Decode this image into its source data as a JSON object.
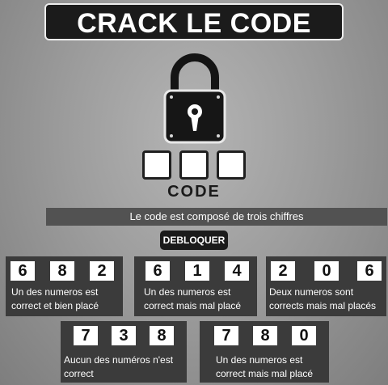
{
  "title": "CRACK LE CODE",
  "lock": {
    "icon": "padlock-icon",
    "code_label": "CODE",
    "slots": [
      "",
      "",
      ""
    ]
  },
  "info": "Le code est composé de trois chiffres",
  "unlock_button": "DEBLOQUER",
  "clues": [
    {
      "digits": [
        "6",
        "8",
        "2"
      ],
      "text_lines": [
        "Un des numeros est",
        "correct et bien placé"
      ]
    },
    {
      "digits": [
        "6",
        "1",
        "4"
      ],
      "text_lines": [
        "Un des numeros est",
        "correct mais mal placé"
      ]
    },
    {
      "digits": [
        "2",
        "0",
        "6"
      ],
      "text_lines": [
        "Deux numeros sont",
        "corrects mais mal placés"
      ]
    },
    {
      "digits": [
        "7",
        "3",
        "8"
      ],
      "text_lines": [
        "Aucun des numéros n'est",
        "correct"
      ]
    },
    {
      "digits": [
        "7",
        "8",
        "0"
      ],
      "text_lines": [
        "Un des numeros est",
        "correct mais mal placé"
      ]
    }
  ],
  "colors": {
    "panel": "#3b3b3b",
    "bar": "#525252",
    "dark": "#1b1b1b"
  }
}
